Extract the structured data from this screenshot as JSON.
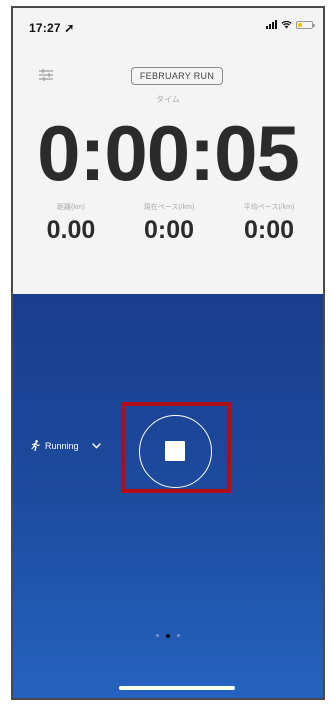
{
  "status_bar": {
    "time": "17:27 ➚",
    "battery_level": 0.3
  },
  "header": {
    "filter_icon": "sliders-icon",
    "title": "FEBRUARY RUN"
  },
  "timer": {
    "label": "タイム",
    "value": "0:00:05"
  },
  "metrics": [
    {
      "label": "距離(km)",
      "value": "0.00"
    },
    {
      "label": "現在ペース(/km)",
      "value": "0:00"
    },
    {
      "label": "平均ペース(/km)",
      "value": "0:00"
    }
  ],
  "activity": {
    "icon": "running-person-icon",
    "label": "Running",
    "chevron_icon": "chevron-down-icon"
  },
  "stop_button": {
    "icon": "stop-icon"
  },
  "pagination": {
    "count": 3,
    "active": 1
  },
  "colors": {
    "panel_top": "#193e8d",
    "panel_bottom": "#2563c0",
    "highlight": "#b00d18"
  }
}
